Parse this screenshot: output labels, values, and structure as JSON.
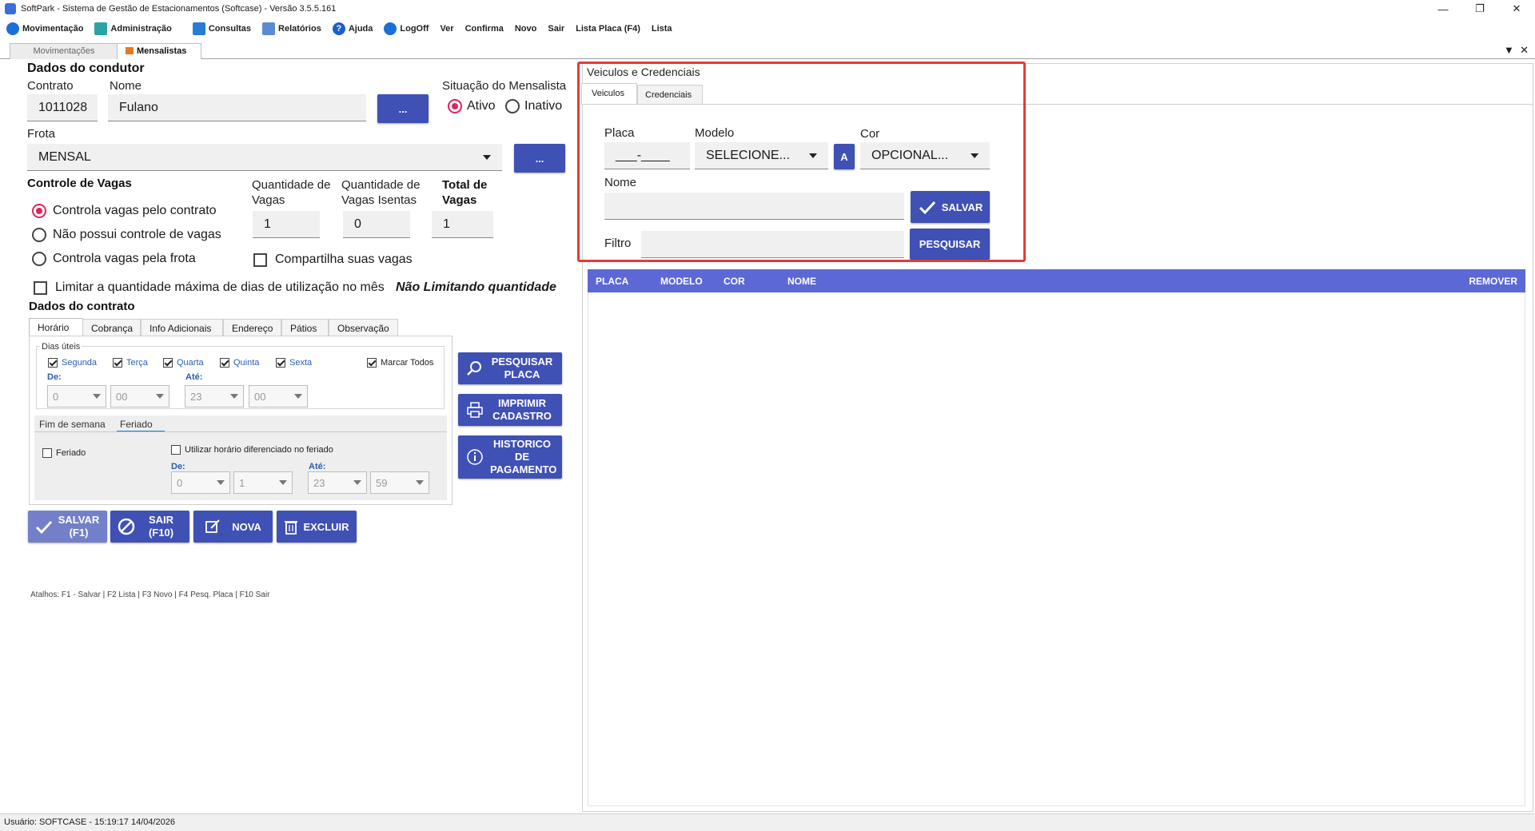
{
  "window": {
    "title": "SoftPark - Sistema de Gestão de Estacionamentos (Softcase) - Versão 3.5.5.161"
  },
  "menu": [
    {
      "label": "Movimentação",
      "color": "#1a6fd8"
    },
    {
      "label": "Administração",
      "color": "#2aa3a3"
    },
    {
      "label": "Consultas",
      "color": "#2a7bd8"
    },
    {
      "label": "Relatórios",
      "color": "#5a8ad0"
    },
    {
      "label": "Ajuda",
      "color": "#1a5fd0"
    },
    {
      "label": "LogOff",
      "color": "#1a6fd8"
    },
    {
      "label": "Ver"
    },
    {
      "label": "Confirma"
    },
    {
      "label": "Novo"
    },
    {
      "label": "Sair"
    },
    {
      "label": "Lista Placa (F4)"
    },
    {
      "label": "Lista"
    }
  ],
  "doc_tabs": [
    {
      "label": "Movimentações"
    },
    {
      "label": "Mensalistas"
    }
  ],
  "driver": {
    "section_title": "Dados do condutor",
    "contract_label": "Contrato",
    "contract_value": "1011028",
    "name_label": "Nome",
    "name_value": "Fulano",
    "lookup_btn": "...",
    "status_label": "Situação do Mensalista",
    "status_active": "Ativo",
    "status_inactive": "Inativo",
    "fleet_label": "Frota",
    "fleet_value": "MENSAL"
  },
  "vagas": {
    "title": "Controle de Vagas",
    "opt1": "Controla vagas pelo contrato",
    "opt2": "Não possui controle de vagas",
    "opt3": "Controla vagas pela frota",
    "qty_label": "Quantidade de Vagas",
    "qty_value": "1",
    "exempt_label": "Quantidade de Vagas Isentas",
    "exempt_value": "0",
    "total_label": "Total de Vagas",
    "total_value": "1",
    "share_label": "Compartilha suas vagas",
    "limit_label": "Limitar a quantidade máxima de dias de utilização no mês",
    "limit_status": "Não Limitando quantidade"
  },
  "contract": {
    "title": "Dados do contrato",
    "tabs": [
      "Horário",
      "Cobrança",
      "Info Adicionais",
      "Endereço",
      "Pátios",
      "Observação"
    ],
    "weekdays_title": "Dias úteis",
    "days": [
      "Segunda",
      "Terça",
      "Quarta",
      "Quinta",
      "Sexta"
    ],
    "mark_all": "Marcar Todos",
    "from_label": "De:",
    "to_label": "Até:",
    "from_h": "0",
    "from_m": "00",
    "to_h": "23",
    "to_m": "00",
    "subtabs": [
      "Fim de semana",
      "Feriado"
    ],
    "holiday_label": "Feriado",
    "holiday_diff_label": "Utilizar horário diferenciado no feriado",
    "hol_from_h": "0",
    "hol_from_m": "1",
    "hol_to_h": "23",
    "hol_to_m": "59"
  },
  "side_buttons": {
    "search_plate": "PESQUISAR PLACA",
    "print": "IMPRIMIR CADASTRO",
    "history": "HISTORICO DE PAGAMENTO"
  },
  "actions": {
    "save": "SALVAR (F1)",
    "exit": "SAIR (F10)",
    "new": "NOVA",
    "delete": "EXCLUIR"
  },
  "shortcuts": "Atalhos: F1 - Salvar | F2 Lista | F3 Novo | F4 Pesq. Placa | F10 Sair",
  "vehicles": {
    "title": "Veiculos e Credenciais",
    "tabs": [
      "Veiculos",
      "Credenciais"
    ],
    "plate_label": "Placa",
    "plate_value": "___-____",
    "model_label": "Modelo",
    "model_value": "SELECIONE...",
    "a_btn": "A",
    "color_label": "Cor",
    "color_value": "OPCIONAL...",
    "name_label": "Nome",
    "name_value": "",
    "save_btn": "SALVAR",
    "filter_label": "Filtro",
    "filter_value": "",
    "search_btn": "PESQUISAR",
    "columns": [
      "PLACA",
      "MODELO",
      "COR",
      "NOME",
      "REMOVER"
    ]
  },
  "status_bar": "Usuário:  SOFTCASE - 15:19:17 14/04/2026",
  "colors": {
    "accent": "#3f51b5",
    "grid_header": "#5c68d6",
    "highlight": "#e53935"
  }
}
